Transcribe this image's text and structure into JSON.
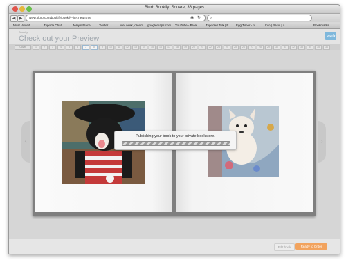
{
  "window": {
    "title": "Blurb Bookify: Square, 36 pages"
  },
  "browser": {
    "url": "www.blurb.com/bookify/bookify-lite?new=true",
    "url_prefix": "www.",
    "url_domain": "blurb.com",
    "bookmarks": [
      "Most Visited",
      "Tripoda Chat",
      "Jerry's Place",
      "Twitter",
      "live, work, dream...",
      "googlemaps.com",
      "YouTube - Broa...",
      "Tripoded Talk | E...",
      "Egg Timer - o...",
      "Info | Basic | a...",
      "Bookmarks"
    ]
  },
  "header": {
    "overline": "Bookify",
    "title": "Check out your Preview",
    "logo_text": "blurb"
  },
  "pagestrip": {
    "first_label": "Cover",
    "pages": [
      "1",
      "2",
      "3",
      "4",
      "5",
      "6",
      "7",
      "8",
      "9",
      "10",
      "11",
      "12",
      "13",
      "14",
      "15",
      "16",
      "17",
      "18",
      "19",
      "20",
      "21",
      "22",
      "23",
      "24",
      "25",
      "26",
      "27",
      "28",
      "29",
      "30",
      "31",
      "32",
      "33",
      "34",
      "35",
      "36"
    ],
    "active_index": 6
  },
  "modal": {
    "message": "Publishing your book to your private bookstore.",
    "progress": "indeterminate"
  },
  "footer": {
    "edit_label": "Edit book",
    "order_label": "Ready to Order"
  },
  "colors": {
    "accent_orange": "#f2a35e",
    "logo_blue": "#7fb8dc"
  },
  "icons": [
    "back-arrow-icon",
    "forward-arrow-icon",
    "reload-icon",
    "rss-icon",
    "search-icon",
    "prev-page-icon",
    "next-page-icon"
  ]
}
